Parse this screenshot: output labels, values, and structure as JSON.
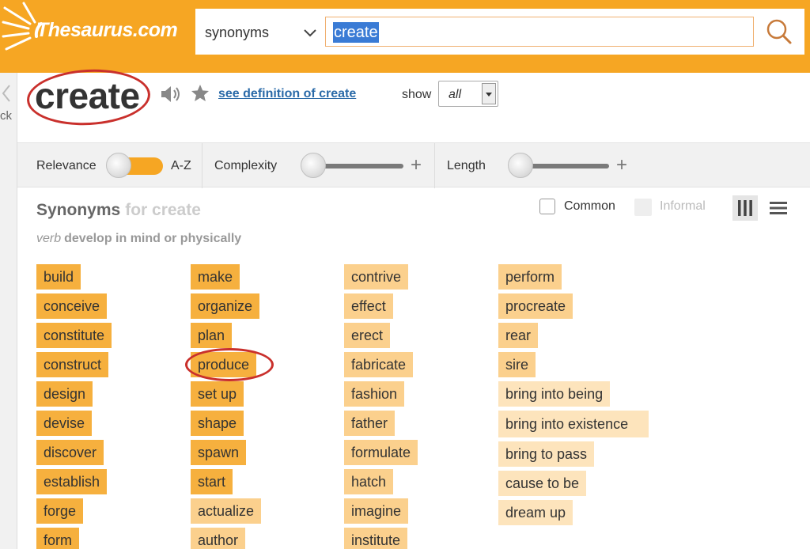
{
  "logo": {
    "text": "Thesaurus.com"
  },
  "search": {
    "type_value": "synonyms",
    "query": "create"
  },
  "left_edge_text": "ck",
  "entry": {
    "word": "create",
    "definition_link": "see definition of create",
    "show_label": "show",
    "show_value": "all"
  },
  "filters": {
    "relevance": "Relevance",
    "az": "A-Z",
    "complexity": "Complexity",
    "length": "Length"
  },
  "results": {
    "heading": "Synonyms",
    "heading_for": "for create",
    "sense_pos": "verb",
    "sense_def": "develop in mind or physically",
    "common_label": "Common",
    "informal_label": "Informal"
  },
  "columns": [
    [
      {
        "text": "build",
        "rel": 3
      },
      {
        "text": "conceive",
        "rel": 3
      },
      {
        "text": "constitute",
        "rel": 3
      },
      {
        "text": "construct",
        "rel": 3
      },
      {
        "text": "design",
        "rel": 3
      },
      {
        "text": "devise",
        "rel": 3
      },
      {
        "text": "discover",
        "rel": 3
      },
      {
        "text": "establish",
        "rel": 3
      },
      {
        "text": "forge",
        "rel": 3
      },
      {
        "text": "form",
        "rel": 3
      }
    ],
    [
      {
        "text": "make",
        "rel": 3
      },
      {
        "text": "organize",
        "rel": 3
      },
      {
        "text": "plan",
        "rel": 3
      },
      {
        "text": "produce",
        "rel": 3
      },
      {
        "text": "set up",
        "rel": 3
      },
      {
        "text": "shape",
        "rel": 3
      },
      {
        "text": "spawn",
        "rel": 3
      },
      {
        "text": "start",
        "rel": 3
      },
      {
        "text": "actualize",
        "rel": 2
      },
      {
        "text": "author",
        "rel": 2
      }
    ],
    [
      {
        "text": "contrive",
        "rel": 2
      },
      {
        "text": "effect",
        "rel": 2
      },
      {
        "text": "erect",
        "rel": 2
      },
      {
        "text": "fabricate",
        "rel": 2
      },
      {
        "text": "fashion",
        "rel": 2
      },
      {
        "text": "father",
        "rel": 2
      },
      {
        "text": "formulate",
        "rel": 2
      },
      {
        "text": "hatch",
        "rel": 2
      },
      {
        "text": "imagine",
        "rel": 2
      },
      {
        "text": "institute",
        "rel": 2
      }
    ],
    [
      {
        "text": "perform",
        "rel": 2
      },
      {
        "text": "procreate",
        "rel": 2
      },
      {
        "text": "rear",
        "rel": 2
      },
      {
        "text": "sire",
        "rel": 2
      },
      {
        "text": "bring into being",
        "rel": 1
      },
      {
        "text": "bring into existence",
        "rel": 1
      },
      {
        "text": "bring to pass",
        "rel": 1
      },
      {
        "text": "cause to be",
        "rel": 1
      },
      {
        "text": "dream up",
        "rel": 1
      }
    ]
  ],
  "colors": {
    "brand": "#f6a623",
    "relevance_high": "#f6b03e",
    "relevance_mid": "#fbd08d",
    "relevance_low": "#fde4bc",
    "link": "#2a6aa8",
    "highlight_ring": "#c9302c"
  }
}
